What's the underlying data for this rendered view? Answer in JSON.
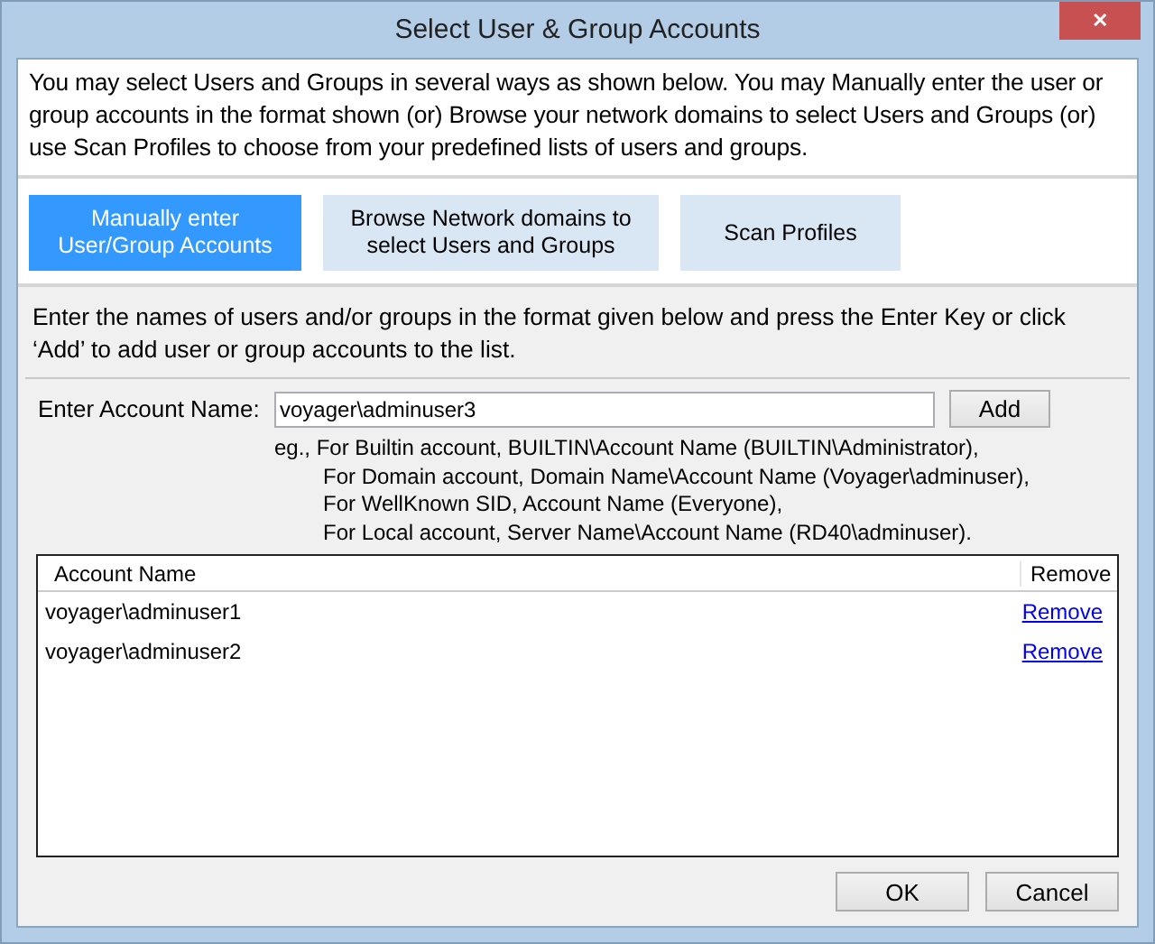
{
  "window": {
    "title": "Select User & Group Accounts",
    "close": "✕"
  },
  "intro": "You may select Users and Groups in several ways as shown below. You may Manually enter the user or group accounts in the format shown (or) Browse your network domains to select Users and Groups (or) use Scan Profiles to choose from your predefined lists of users and groups.",
  "modes": [
    {
      "lines": [
        "Manually enter",
        "User/Group Accounts"
      ],
      "selected": true
    },
    {
      "lines": [
        "Browse Network domains to",
        "select Users and Groups"
      ],
      "selected": false
    },
    {
      "lines": [
        "Scan Profiles"
      ],
      "selected": false
    }
  ],
  "instructions": "Enter the names of users and/or groups in the format given below and press the Enter Key or click ‘Add’ to add user or group accounts to the list.",
  "account_field": {
    "label": "Enter Account Name:",
    "value": "voyager\\adminuser3"
  },
  "add_button": {
    "label": "Add"
  },
  "examples": [
    "eg., For Builtin account, BUILTIN\\Account Name (BUILTIN\\Administrator),",
    "For Domain account, Domain Name\\Account Name (Voyager\\adminuser),",
    "For WellKnown SID, Account Name (Everyone),",
    "For Local account, Server Name\\Account Name (RD40\\adminuser)."
  ],
  "table": {
    "columns": [
      "Account Name",
      "Remove"
    ],
    "rows": [
      {
        "account": "voyager\\adminuser1",
        "action": "Remove"
      },
      {
        "account": "voyager\\adminuser2",
        "action": "Remove"
      }
    ]
  },
  "buttons": [
    {
      "label": "OK"
    },
    {
      "label": "Cancel"
    }
  ]
}
